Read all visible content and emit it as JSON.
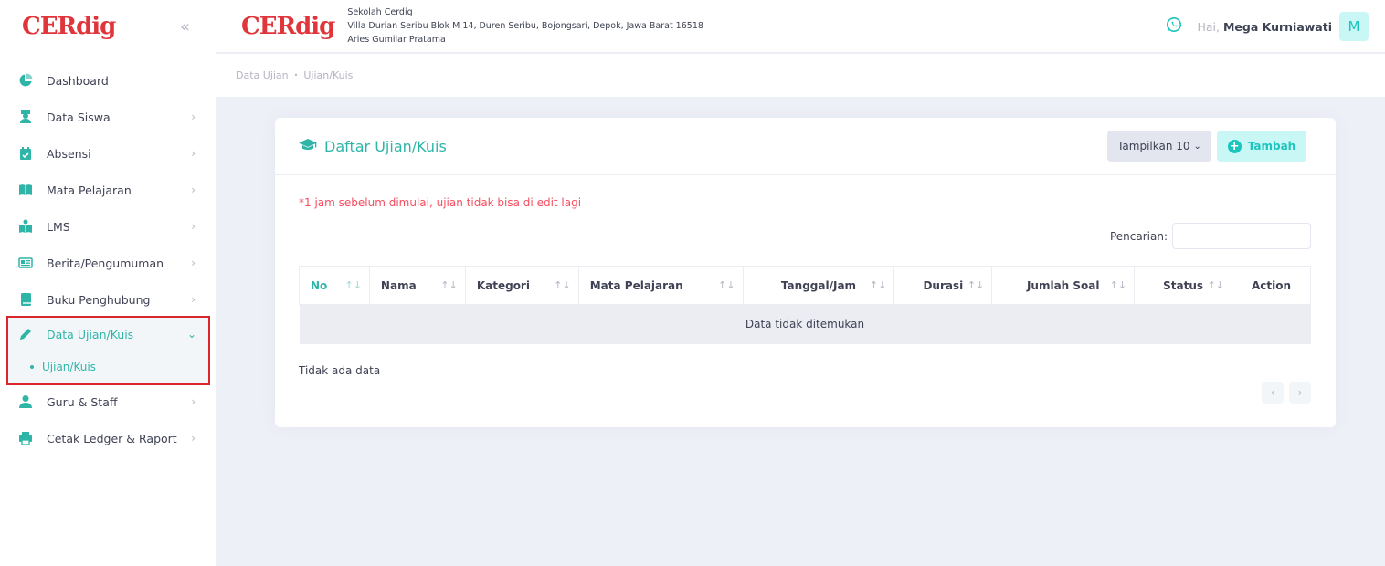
{
  "brand": {
    "logo": "CERdig"
  },
  "school": {
    "name": "Sekolah Cerdig",
    "address": "Villa Durian Seribu Blok M 14, Duren Seribu, Bojongsari, Depok, Jawa Barat 16518",
    "person": "Aries Gumilar Pratama"
  },
  "user": {
    "greeting": "Hai,",
    "name": "Mega Kurniawati",
    "initial": "M"
  },
  "colors": {
    "accent": "#2eb5a8",
    "brand_red": "#e0353b",
    "highlight_border": "#d9252b",
    "note": "#f64e60"
  },
  "sidebar": {
    "collapse_icon": "double-chevron-left-icon",
    "items": [
      {
        "label": "Dashboard",
        "icon": "pie-chart-icon"
      },
      {
        "label": "Data Siswa",
        "icon": "student-icon"
      },
      {
        "label": "Absensi",
        "icon": "calendar-check-icon"
      },
      {
        "label": "Mata Pelajaran",
        "icon": "book-open-icon"
      },
      {
        "label": "LMS",
        "icon": "reading-icon"
      },
      {
        "label": "Berita/Pengumuman",
        "icon": "newspaper-icon"
      },
      {
        "label": "Buku Penghubung",
        "icon": "book-icon"
      },
      {
        "label": "Data Ujian/Kuis",
        "icon": "pencil-icon",
        "active": true,
        "sub": [
          "Ujian/Kuis"
        ]
      },
      {
        "label": "Guru & Staff",
        "icon": "user-icon"
      },
      {
        "label": "Cetak Ledger & Raport",
        "icon": "printer-icon"
      }
    ]
  },
  "breadcrumb": [
    "Data Ujian",
    "Ujian/Kuis"
  ],
  "card": {
    "title": "Daftar Ujian/Kuis",
    "title_icon": "graduation-cap-icon",
    "show_label": "Tampilkan 10",
    "add_label": "Tambah",
    "note": "*1 jam sebelum dimulai, ujian tidak bisa di edit lagi",
    "search_label": "Pencarian:",
    "search_value": "",
    "columns": [
      "No",
      "Nama",
      "Kategori",
      "Mata Pelajaran",
      "Tanggal/Jam",
      "Durasi",
      "Jumlah Soal",
      "Status",
      "Action"
    ],
    "empty_text": "Data tidak ditemukan",
    "info_text": "Tidak ada data",
    "pager": {
      "prev": "‹",
      "next": "›"
    }
  }
}
